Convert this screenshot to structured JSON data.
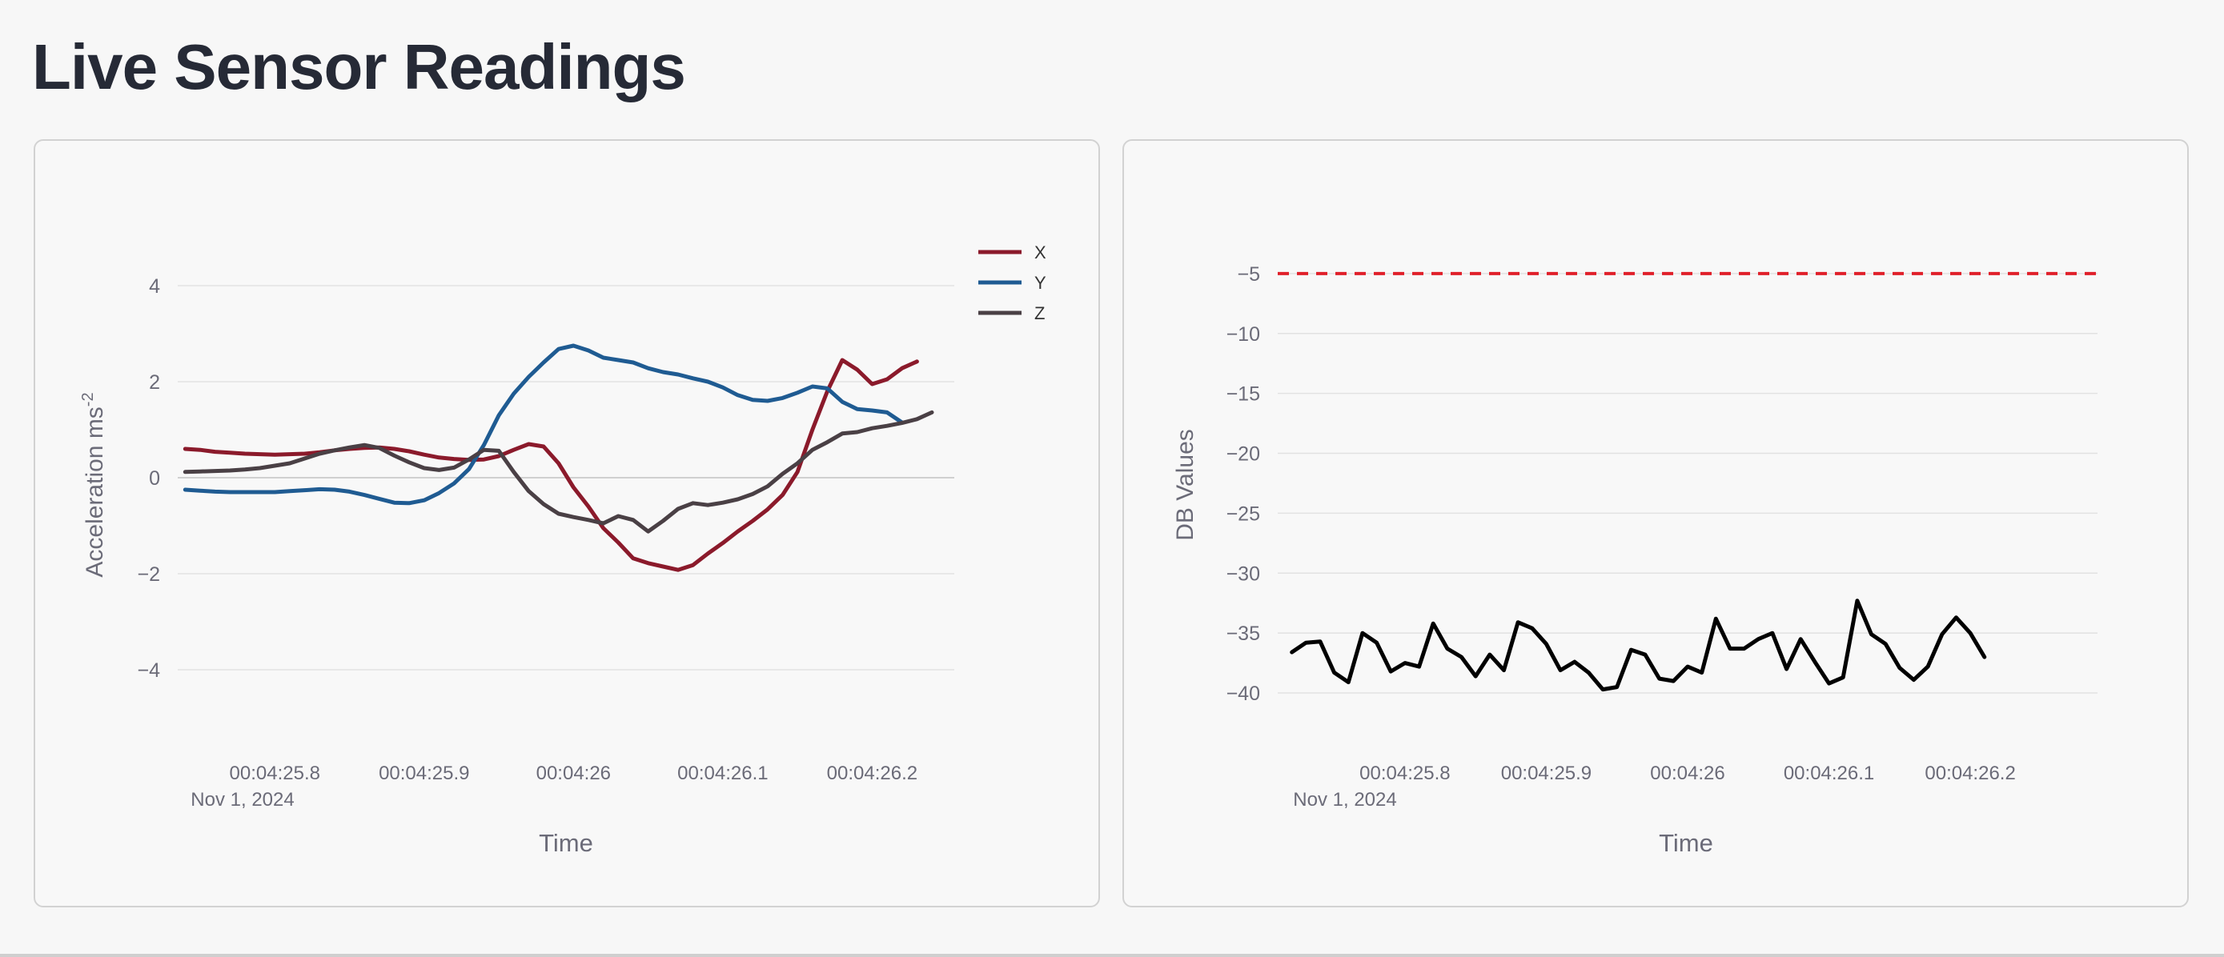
{
  "page": {
    "title": "Live Sensor Readings"
  },
  "chart_data": [
    {
      "type": "line",
      "xlabel": "Time",
      "ylabel": "Acceleration ms",
      "ylabel_sup": "-2",
      "xlim": [
        25.735,
        26.255
      ],
      "ylim": [
        -5,
        5
      ],
      "x_tick_values": [
        25.8,
        25.9,
        26.0,
        26.1,
        26.2
      ],
      "x_tick_labels": [
        "00:04:25.8",
        "00:04:25.9",
        "00:04:26",
        "00:04:26.1",
        "00:04:26.2"
      ],
      "x_date_label": "Nov 1, 2024",
      "y_ticks": [
        4,
        2,
        0,
        -2,
        -4
      ],
      "y_tick_labels": [
        "4",
        "2",
        "0",
        "−2",
        "−4"
      ],
      "grid": true,
      "legend_position": "top-right",
      "x": [
        25.74,
        25.75,
        25.76,
        25.77,
        25.78,
        25.79,
        25.8,
        25.81,
        25.82,
        25.83,
        25.84,
        25.85,
        25.86,
        25.87,
        25.88,
        25.89,
        25.9,
        25.91,
        25.92,
        25.93,
        25.94,
        25.95,
        25.96,
        25.97,
        25.98,
        25.99,
        26.0,
        26.01,
        26.02,
        26.03,
        26.04,
        26.05,
        26.06,
        26.07,
        26.08,
        26.09,
        26.1,
        26.11,
        26.12,
        26.13,
        26.14,
        26.15,
        26.16,
        26.17,
        26.18,
        26.19,
        26.2,
        26.21,
        26.22,
        26.23,
        26.24,
        26.25
      ],
      "series": [
        {
          "name": "X",
          "color": "#8b1a2b",
          "values": [
            0.6,
            0.58,
            0.54,
            0.52,
            0.5,
            0.49,
            0.48,
            0.49,
            0.5,
            0.53,
            0.57,
            0.6,
            0.62,
            0.63,
            0.6,
            0.55,
            0.48,
            0.42,
            0.39,
            0.37,
            0.38,
            0.45,
            0.58,
            0.7,
            0.65,
            0.3,
            -0.2,
            -0.6,
            -1.05,
            -1.35,
            -1.68,
            -1.78,
            -1.85,
            -1.92,
            -1.82,
            -1.58,
            -1.36,
            -1.12,
            -0.9,
            -0.66,
            -0.36,
            0.12,
            1.0,
            1.8,
            2.45,
            2.25,
            1.95,
            2.05,
            2.28,
            2.42
          ]
        },
        {
          "name": "Y",
          "color": "#1f5b92",
          "values": [
            -0.25,
            -0.27,
            -0.29,
            -0.3,
            -0.3,
            -0.3,
            -0.3,
            -0.28,
            -0.26,
            -0.24,
            -0.25,
            -0.29,
            -0.36,
            -0.44,
            -0.52,
            -0.53,
            -0.47,
            -0.32,
            -0.12,
            0.18,
            0.68,
            1.3,
            1.75,
            2.1,
            2.4,
            2.68,
            2.75,
            2.65,
            2.5,
            2.45,
            2.4,
            2.28,
            2.2,
            2.15,
            2.07,
            2.0,
            1.88,
            1.72,
            1.62,
            1.6,
            1.66,
            1.77,
            1.9,
            1.86,
            1.58,
            1.43,
            1.4,
            1.36,
            1.15
          ]
        },
        {
          "name": "Z",
          "color": "#4a4045",
          "values": [
            0.12,
            0.13,
            0.14,
            0.15,
            0.17,
            0.2,
            0.25,
            0.3,
            0.4,
            0.5,
            0.57,
            0.63,
            0.68,
            0.62,
            0.46,
            0.32,
            0.2,
            0.16,
            0.21,
            0.38,
            0.58,
            0.56,
            0.12,
            -0.28,
            -0.55,
            -0.75,
            -0.82,
            -0.88,
            -0.95,
            -0.8,
            -0.88,
            -1.12,
            -0.9,
            -0.65,
            -0.53,
            -0.57,
            -0.52,
            -0.45,
            -0.34,
            -0.18,
            0.08,
            0.3,
            0.58,
            0.74,
            0.92,
            0.95,
            1.03,
            1.08,
            1.14,
            1.22,
            1.36
          ]
        }
      ]
    },
    {
      "type": "line",
      "xlabel": "Time",
      "ylabel": "DB Values",
      "xlim": [
        25.71,
        26.29
      ],
      "ylim": [
        -42.2,
        -1.2
      ],
      "x_tick_values": [
        25.8,
        25.9,
        26.0,
        26.1,
        26.2
      ],
      "x_tick_labels": [
        "00:04:25.8",
        "00:04:25.9",
        "00:04:26",
        "00:04:26.1",
        "00:04:26.2"
      ],
      "x_date_label": "Nov 1, 2024",
      "y_ticks": [
        -5,
        -10,
        -15,
        -20,
        -25,
        -30,
        -35,
        -40
      ],
      "y_tick_labels": [
        "−5",
        "−10",
        "−15",
        "−20",
        "−25",
        "−30",
        "−35",
        "−40"
      ],
      "grid": true,
      "threshold": {
        "value": -5,
        "color": "#e0202a",
        "style": "dashed"
      },
      "x": [
        25.72,
        25.73,
        25.74,
        25.75,
        25.76,
        25.77,
        25.78,
        25.79,
        25.8,
        25.81,
        25.82,
        25.83,
        25.84,
        25.85,
        25.86,
        25.87,
        25.88,
        25.89,
        25.9,
        25.91,
        25.92,
        25.93,
        25.94,
        25.95,
        25.96,
        25.97,
        25.98,
        25.99,
        26.0,
        26.01,
        26.02,
        26.03,
        26.04,
        26.05,
        26.06,
        26.07,
        26.08,
        26.09,
        26.1,
        26.11,
        26.12,
        26.13,
        26.14,
        26.15,
        26.16,
        26.17,
        26.18,
        26.19,
        26.2,
        26.21,
        26.22,
        26.23,
        26.24,
        26.25,
        26.26,
        26.27,
        26.28
      ],
      "series": [
        {
          "name": "",
          "color": "#000000",
          "values": [
            -36.6,
            -35.8,
            -35.7,
            -38.3,
            -39.1,
            -35.0,
            -35.8,
            -38.2,
            -37.5,
            -37.8,
            -34.2,
            -36.3,
            -37.0,
            -38.6,
            -36.8,
            -38.1,
            -34.1,
            -34.6,
            -35.9,
            -38.1,
            -37.4,
            -38.3,
            -39.7,
            -39.5,
            -36.4,
            -36.8,
            -38.8,
            -39.0,
            -37.8,
            -38.3,
            -33.8,
            -36.3,
            -36.3,
            -35.5,
            -35.0,
            -38.0,
            -35.5,
            -37.4,
            -39.2,
            -38.7,
            -32.3,
            -35.1,
            -35.9,
            -37.9,
            -38.9,
            -37.8,
            -35.1,
            -33.7,
            -35.0,
            -37.0
          ]
        }
      ]
    }
  ]
}
